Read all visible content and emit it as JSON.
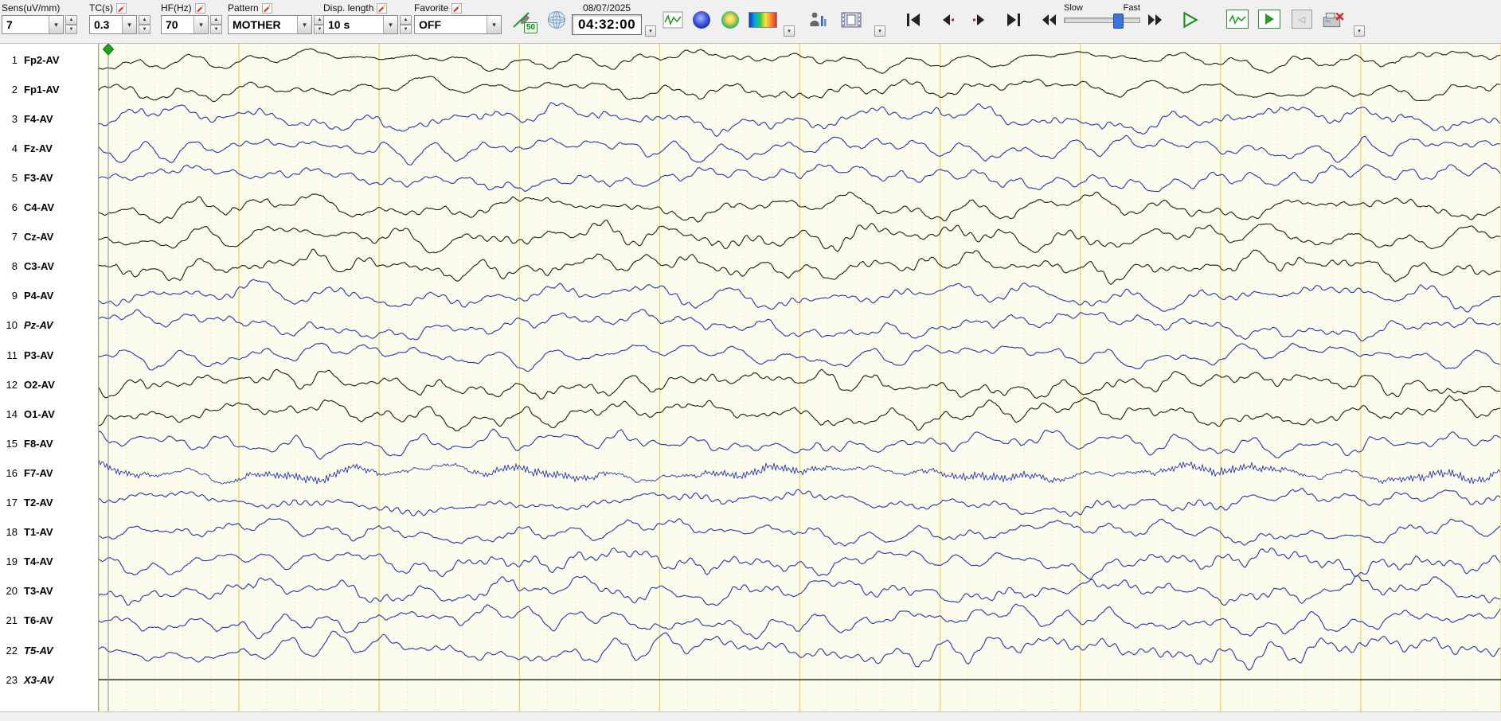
{
  "toolbar": {
    "sens": {
      "label": "Sens(uV/mm)",
      "value": "7"
    },
    "tc": {
      "label": "TC(s)",
      "value": "0.3"
    },
    "hf": {
      "label": "HF(Hz)",
      "value": "70"
    },
    "pattern": {
      "label": "Pattern",
      "value": "MOTHER"
    },
    "disp_length": {
      "label": "Disp. length",
      "value": "10 s"
    },
    "favorite": {
      "label": "Favorite",
      "value": "OFF"
    },
    "notch_badge": "50",
    "date": "08/07/2025",
    "time": "04:32:00",
    "speed": {
      "slow": "Slow",
      "fast": "Fast"
    }
  },
  "grid": {
    "display_seconds": 10,
    "minor_per_second": 5
  },
  "colors": {
    "trace_black": "#1c1c1c",
    "trace_blue": "#2a35a8",
    "bg": "#fbfbee",
    "grid_major": "#e6d84f",
    "grid_minor": "#efe9ad",
    "cursor": "#8f8f8f",
    "marker": "#1fa51f"
  },
  "channels": [
    {
      "num": "1",
      "label": "Fp2-AV",
      "color": "black",
      "italic": false,
      "amp": 10,
      "seed": 11,
      "dense": false
    },
    {
      "num": "2",
      "label": "Fp1-AV",
      "color": "black",
      "italic": false,
      "amp": 11,
      "seed": 23,
      "dense": false
    },
    {
      "num": "3",
      "label": "F4-AV",
      "color": "blue",
      "italic": false,
      "amp": 13,
      "seed": 37,
      "dense": false
    },
    {
      "num": "4",
      "label": "Fz-AV",
      "color": "blue",
      "italic": false,
      "amp": 12,
      "seed": 41,
      "dense": false
    },
    {
      "num": "5",
      "label": "F3-AV",
      "color": "blue",
      "italic": false,
      "amp": 12,
      "seed": 53,
      "dense": false
    },
    {
      "num": "6",
      "label": "C4-AV",
      "color": "black",
      "italic": false,
      "amp": 13,
      "seed": 67,
      "dense": false
    },
    {
      "num": "7",
      "label": "Cz-AV",
      "color": "black",
      "italic": false,
      "amp": 14,
      "seed": 71,
      "dense": false
    },
    {
      "num": "8",
      "label": "C3-AV",
      "color": "black",
      "italic": false,
      "amp": 13,
      "seed": 83,
      "dense": false
    },
    {
      "num": "9",
      "label": "P4-AV",
      "color": "blue",
      "italic": false,
      "amp": 13,
      "seed": 97,
      "dense": false
    },
    {
      "num": "10",
      "label": "Pz-AV",
      "color": "blue",
      "italic": true,
      "amp": 13,
      "seed": 103,
      "dense": false
    },
    {
      "num": "11",
      "label": "P3-AV",
      "color": "blue",
      "italic": false,
      "amp": 12,
      "seed": 113,
      "dense": false
    },
    {
      "num": "12",
      "label": "O2-AV",
      "color": "black",
      "italic": false,
      "amp": 13,
      "seed": 127,
      "dense": false
    },
    {
      "num": "14",
      "label": "O1-AV",
      "color": "black",
      "italic": false,
      "amp": 14,
      "seed": 139,
      "dense": false
    },
    {
      "num": "15",
      "label": "F8-AV",
      "color": "blue",
      "italic": false,
      "amp": 12,
      "seed": 151,
      "dense": false
    },
    {
      "num": "16",
      "label": "F7-AV",
      "color": "blue",
      "italic": false,
      "amp": 9,
      "seed": 163,
      "dense": true
    },
    {
      "num": "17",
      "label": "T2-AV",
      "color": "blue",
      "italic": false,
      "amp": 12,
      "seed": 173,
      "dense": false
    },
    {
      "num": "18",
      "label": "T1-AV",
      "color": "blue",
      "italic": false,
      "amp": 12,
      "seed": 181,
      "dense": false
    },
    {
      "num": "19",
      "label": "T4-AV",
      "color": "blue",
      "italic": false,
      "amp": 13,
      "seed": 193,
      "dense": false
    },
    {
      "num": "20",
      "label": "T3-AV",
      "color": "blue",
      "italic": false,
      "amp": 13,
      "seed": 199,
      "dense": false
    },
    {
      "num": "21",
      "label": "T6-AV",
      "color": "blue",
      "italic": false,
      "amp": 14,
      "seed": 211,
      "dense": false
    },
    {
      "num": "22",
      "label": "T5-AV",
      "color": "blue",
      "italic": true,
      "amp": 15,
      "seed": 223,
      "dense": false
    },
    {
      "num": "23",
      "label": "X3-AV",
      "color": "black",
      "italic": true,
      "amp": 0,
      "seed": 229,
      "dense": false
    }
  ]
}
